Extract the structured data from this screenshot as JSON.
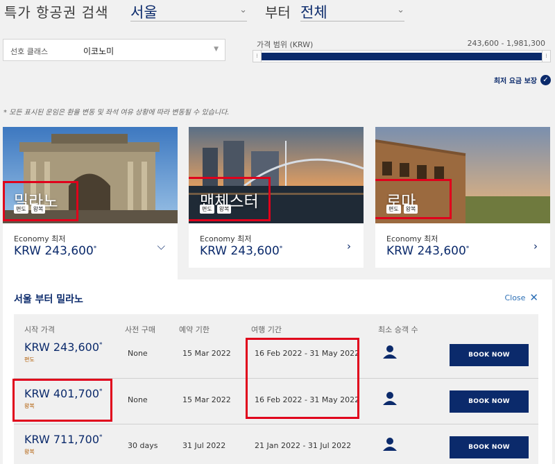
{
  "search": {
    "title": "특가 항공권 검색",
    "origin": "서울",
    "to_label": "부터",
    "destination": "전체"
  },
  "filters": {
    "class_label": "선호 클래스",
    "class_value": "이코노미",
    "price_range_label": "가격 범위 (KRW)",
    "price_range_value": "243,600 - 1,981,300",
    "price_range_fill_fraction": 1.0
  },
  "guarantee": {
    "label": "최저 요금 보장"
  },
  "disclaimer": "* 모든 표시된 운임은 환율 변동 및 좌석 여유 상황에 따라 변동될 수 있습니다.",
  "cards": [
    {
      "city": "밀라노",
      "tags": [
        "편도",
        "왕복"
      ],
      "class_label": "Economy 최저",
      "price": "KRW 243,600",
      "mark": "*",
      "chevron": "down"
    },
    {
      "city": "맨체스터",
      "tags": [
        "편도",
        "왕복"
      ],
      "class_label": "Economy 최저",
      "price": "KRW 243,600",
      "mark": "*",
      "chevron": "right"
    },
    {
      "city": "로마",
      "tags": [
        "편도",
        "왕복"
      ],
      "class_label": "Economy 최저",
      "price": "KRW 243,600",
      "mark": "*",
      "chevron": "right"
    }
  ],
  "detail": {
    "title": "서울 부터 밀라노",
    "close_label": "Close",
    "headers": {
      "start_price": "시작 가격",
      "advance": "사전 구매",
      "booking_deadline": "예약 기한",
      "travel_period": "여행 기간",
      "min_passengers": "최소 승객 수"
    },
    "rows": [
      {
        "price": "KRW 243,600",
        "mark": "*",
        "trip": "편도",
        "advance": "None",
        "deadline": "15 Mar 2022",
        "period": "16 Feb 2022 - 31 May 2022",
        "min_passengers": 1,
        "book_label": "BOOK NOW"
      },
      {
        "price": "KRW 401,700",
        "mark": "*",
        "trip": "왕복",
        "advance": "None",
        "deadline": "15 Mar 2022",
        "period": "16 Feb 2022 - 31 May 2022",
        "min_passengers": 1,
        "book_label": "BOOK NOW"
      },
      {
        "price": "KRW 711,700",
        "mark": "*",
        "trip": "왕복",
        "advance": "30 days",
        "deadline": "31 Jul 2022",
        "period": "21 Jan 2022 - 31 Jul 2022",
        "min_passengers": 1,
        "book_label": "BOOK NOW"
      }
    ]
  },
  "colors": {
    "brand": "#0b2a6b",
    "highlight": "#e0001b",
    "link": "#2c6fb5"
  },
  "icons": {
    "select_chevron": "chevron-down-icon",
    "guarantee": "check-circle-icon",
    "close": "close-icon",
    "passenger": "person-icon"
  }
}
